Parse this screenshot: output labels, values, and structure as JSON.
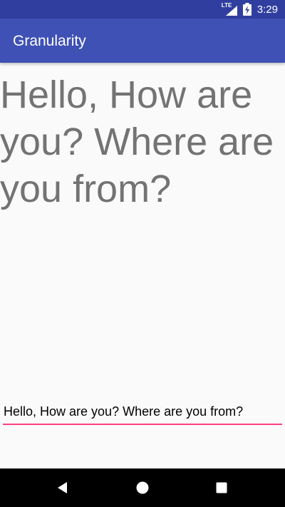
{
  "status_bar": {
    "network_label": "LTE",
    "time": "3:29",
    "icons": [
      "lte-signal-icon",
      "battery-charging-icon"
    ]
  },
  "app_bar": {
    "title": "Granularity"
  },
  "main": {
    "large_text": "Hello, How are you? Where are you from?",
    "input_value": "Hello, How are you? Where are you from?"
  },
  "nav_bar": {
    "buttons": [
      "back-icon",
      "home-icon",
      "recent-apps-icon"
    ]
  },
  "colors": {
    "status_bar": "#303f9f",
    "app_bar": "#3f51b5",
    "accent": "#ff4081",
    "large_text": "#737373"
  }
}
